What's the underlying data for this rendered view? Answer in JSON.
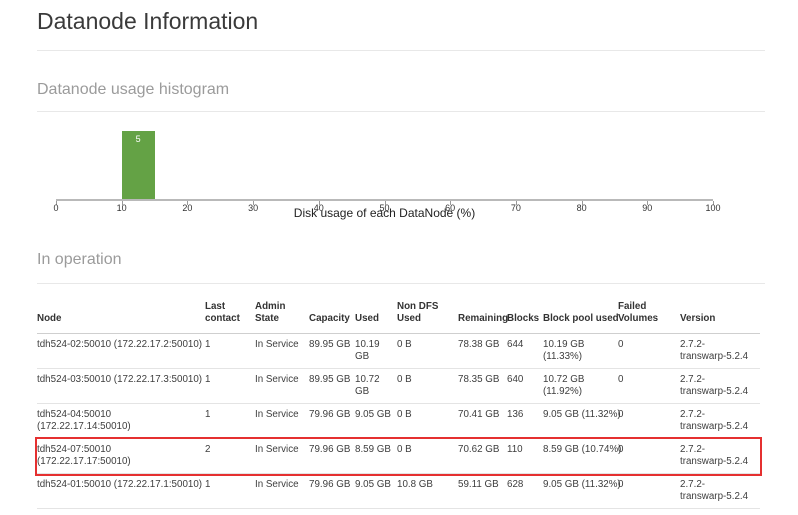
{
  "page_title": "Datanode Information",
  "histogram_section": {
    "heading": "Datanode usage histogram"
  },
  "operation_section": {
    "heading": "In operation"
  },
  "chart_data": {
    "type": "bar",
    "title": "Datanode usage histogram",
    "xlabel": "Disk usage of each DataNode (%)",
    "ylabel": "",
    "xlim": [
      0,
      100
    ],
    "x_ticks": [
      "0",
      "10",
      "20",
      "30",
      "40",
      "50",
      "60",
      "70",
      "80",
      "90",
      "100"
    ],
    "grid": false,
    "bar_color": "#64a245",
    "bins": [
      {
        "range": [
          10,
          15
        ],
        "count": 5,
        "label": "5"
      }
    ]
  },
  "table": {
    "highlight_color": "#e53030",
    "columns": [
      {
        "key": "node",
        "lines": [
          "Node"
        ]
      },
      {
        "key": "last_contact",
        "lines": [
          "Last",
          "contact"
        ]
      },
      {
        "key": "admin_state",
        "lines": [
          "Admin",
          "State"
        ]
      },
      {
        "key": "capacity",
        "lines": [
          "Capacity"
        ]
      },
      {
        "key": "used",
        "lines": [
          "Used"
        ]
      },
      {
        "key": "non_dfs_used",
        "lines": [
          "Non DFS",
          "Used"
        ]
      },
      {
        "key": "remaining",
        "lines": [
          "Remaining"
        ]
      },
      {
        "key": "blocks",
        "lines": [
          "Blocks"
        ]
      },
      {
        "key": "block_pool_used",
        "lines": [
          "Block pool used"
        ]
      },
      {
        "key": "failed_volumes",
        "lines": [
          "Failed",
          "Volumes"
        ]
      },
      {
        "key": "version",
        "lines": [
          "Version"
        ]
      }
    ],
    "rows": [
      {
        "highlighted": false,
        "cells": {
          "node": [
            "tdh524-02:50010 (172.22.17.2:50010)"
          ],
          "last_contact": [
            "1"
          ],
          "admin_state": [
            "In Service"
          ],
          "capacity": [
            "89.95 GB"
          ],
          "used": [
            "10.19",
            "GB"
          ],
          "non_dfs_used": [
            "0 B"
          ],
          "remaining": [
            "78.38 GB"
          ],
          "blocks": [
            "644"
          ],
          "block_pool_used": [
            "10.19 GB",
            "(11.33%)"
          ],
          "failed_volumes": [
            "0"
          ],
          "version": [
            "2.7.2-",
            "transwarp-5.2.4"
          ]
        }
      },
      {
        "highlighted": false,
        "cells": {
          "node": [
            "tdh524-03:50010 (172.22.17.3:50010)"
          ],
          "last_contact": [
            "1"
          ],
          "admin_state": [
            "In Service"
          ],
          "capacity": [
            "89.95 GB"
          ],
          "used": [
            "10.72",
            "GB"
          ],
          "non_dfs_used": [
            "0 B"
          ],
          "remaining": [
            "78.35 GB"
          ],
          "blocks": [
            "640"
          ],
          "block_pool_used": [
            "10.72 GB",
            "(11.92%)"
          ],
          "failed_volumes": [
            "0"
          ],
          "version": [
            "2.7.2-",
            "transwarp-5.2.4"
          ]
        }
      },
      {
        "highlighted": false,
        "cells": {
          "node": [
            "tdh524-04:50010",
            "(172.22.17.14:50010)"
          ],
          "last_contact": [
            "1"
          ],
          "admin_state": [
            "In Service"
          ],
          "capacity": [
            "79.96 GB"
          ],
          "used": [
            "9.05 GB"
          ],
          "non_dfs_used": [
            "0 B"
          ],
          "remaining": [
            "70.41 GB"
          ],
          "blocks": [
            "136"
          ],
          "block_pool_used": [
            "9.05 GB (11.32%)"
          ],
          "failed_volumes": [
            "0"
          ],
          "version": [
            "2.7.2-",
            "transwarp-5.2.4"
          ]
        }
      },
      {
        "highlighted": true,
        "cells": {
          "node": [
            "tdh524-07:50010",
            "(172.22.17.17:50010)"
          ],
          "last_contact": [
            "2"
          ],
          "admin_state": [
            "In Service"
          ],
          "capacity": [
            "79.96 GB"
          ],
          "used": [
            "8.59 GB"
          ],
          "non_dfs_used": [
            "0 B"
          ],
          "remaining": [
            "70.62 GB"
          ],
          "blocks": [
            "110"
          ],
          "block_pool_used": [
            "8.59 GB (10.74%)"
          ],
          "failed_volumes": [
            "0"
          ],
          "version": [
            "2.7.2-",
            "transwarp-5.2.4"
          ]
        }
      },
      {
        "highlighted": false,
        "cells": {
          "node": [
            "tdh524-01:50010 (172.22.17.1:50010)"
          ],
          "last_contact": [
            "1"
          ],
          "admin_state": [
            "In Service"
          ],
          "capacity": [
            "79.96 GB"
          ],
          "used": [
            "9.05 GB"
          ],
          "non_dfs_used": [
            "10.8 GB"
          ],
          "remaining": [
            "59.11 GB"
          ],
          "blocks": [
            "628"
          ],
          "block_pool_used": [
            "9.05 GB (11.32%)"
          ],
          "failed_volumes": [
            "0"
          ],
          "version": [
            "2.7.2-",
            "transwarp-5.2.4"
          ]
        }
      }
    ]
  }
}
